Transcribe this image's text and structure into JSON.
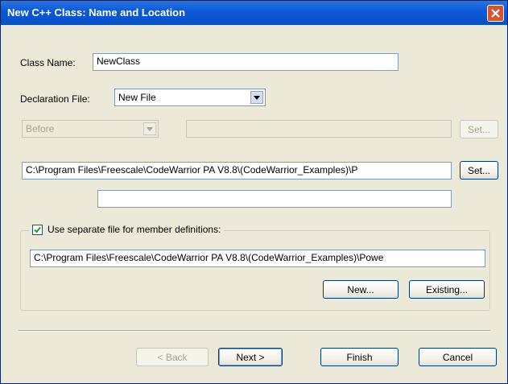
{
  "title": "New C++ Class: Name and Location",
  "class_name": {
    "label": "Class Name:",
    "value": "NewClass"
  },
  "declaration_file": {
    "label": "Declaration File:",
    "value": "New File"
  },
  "relative": {
    "position": "Before",
    "location": "",
    "set_label": "Set..."
  },
  "path": {
    "value": "C:\\Program Files\\Freescale\\CodeWarrior PA V8.8\\(CodeWarrior_Examples)\\P",
    "set_label": "Set...",
    "secondary_value": ""
  },
  "member_defs": {
    "checkbox_label": "Use separate file for member definitions:",
    "checked": true,
    "path": "C:\\Program Files\\Freescale\\CodeWarrior PA V8.8\\(CodeWarrior_Examples)\\Powe",
    "new_label": "New...",
    "existing_label": "Existing..."
  },
  "buttons": {
    "back": "< Back",
    "next": "Next >",
    "finish": "Finish",
    "cancel": "Cancel"
  },
  "icons": {
    "close": "close-icon",
    "dropdown": "chevron-down-icon",
    "check": "check-icon"
  }
}
